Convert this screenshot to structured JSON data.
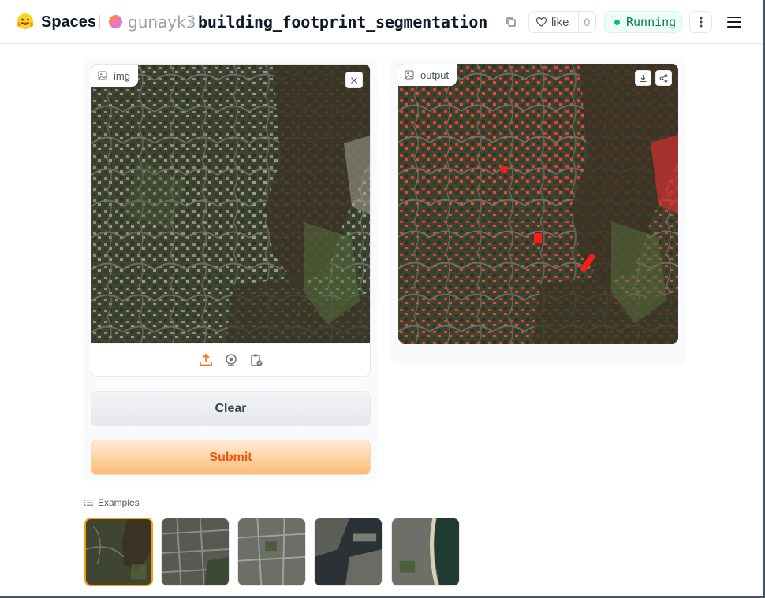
{
  "header": {
    "brand": "Spaces",
    "owner": "gunayk3",
    "separator": "/",
    "repo": "building_footprint_segmentation",
    "like_label": "like",
    "like_count": "0",
    "status": "Running",
    "status_color": "#10b981"
  },
  "input": {
    "label": "img"
  },
  "output": {
    "label": "output"
  },
  "buttons": {
    "clear": "Clear",
    "submit": "Submit"
  },
  "examples": {
    "label": "Examples",
    "count_shown": 5
  },
  "colors": {
    "accent": "#ea580c",
    "submit_gradient_top": "#ffedd5",
    "submit_gradient_bottom": "#fdba74",
    "mask": "#ef4444"
  }
}
